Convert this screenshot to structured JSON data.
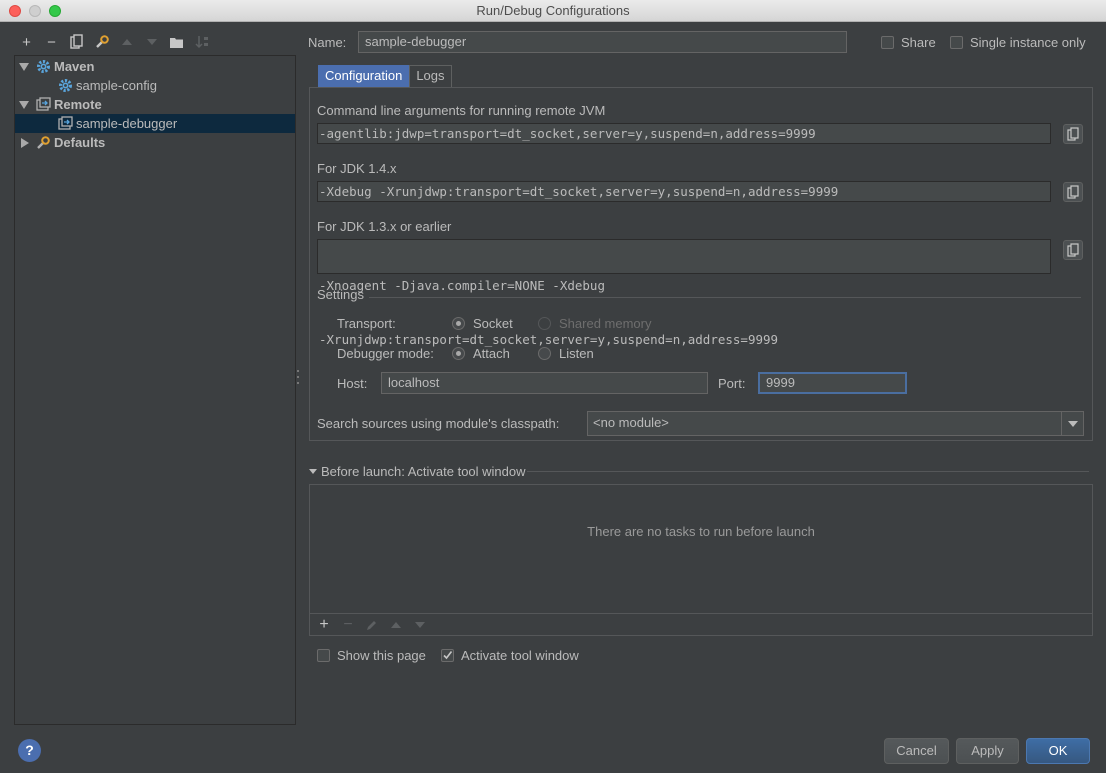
{
  "window": {
    "title": "Run/Debug Configurations"
  },
  "toolbar": {
    "add_label": "+",
    "remove_label": "−"
  },
  "tree": {
    "items": [
      {
        "label": "Maven"
      },
      {
        "label": "sample-config"
      },
      {
        "label": "Remote"
      },
      {
        "label": "sample-debugger"
      },
      {
        "label": "Defaults"
      }
    ]
  },
  "name": {
    "label": "Name:",
    "value": "sample-debugger"
  },
  "share": {
    "label": "Share"
  },
  "single_instance": {
    "label": "Single instance only"
  },
  "tabs": [
    {
      "label": "Configuration"
    },
    {
      "label": "Logs"
    }
  ],
  "config": {
    "cmdline_label": "Command line arguments for running remote JVM",
    "cmdline_value": "-agentlib:jdwp=transport=dt_socket,server=y,suspend=n,address=9999",
    "jdk14_label": "For JDK 1.4.x",
    "jdk14_value": "-Xdebug -Xrunjdwp:transport=dt_socket,server=y,suspend=n,address=9999",
    "jdk13_label": "For JDK 1.3.x or earlier",
    "jdk13_line1": "-Xnoagent -Djava.compiler=NONE -Xdebug",
    "jdk13_line2": "-Xrunjdwp:transport=dt_socket,server=y,suspend=n,address=9999",
    "settings_label": "Settings",
    "transport_label": "Transport:",
    "transport_options": [
      "Socket",
      "Shared memory"
    ],
    "debugger_mode_label": "Debugger mode:",
    "debugger_mode_options": [
      "Attach",
      "Listen"
    ],
    "host_label": "Host:",
    "host_value": "localhost",
    "port_label": "Port:",
    "port_value": "9999",
    "module_label": "Search sources using module's classpath:",
    "module_value": "<no module>"
  },
  "before_launch": {
    "title": "Before launch: Activate tool window",
    "empty_text": "There are no tasks to run before launch"
  },
  "show_page": {
    "label": "Show this page"
  },
  "activate_tool_window": {
    "label": "Activate tool window",
    "checked": true
  },
  "buttons": {
    "cancel": "Cancel",
    "apply": "Apply",
    "ok": "OK",
    "help": "?"
  },
  "colors": {
    "accent": "#4b6eaf",
    "selection": "#0d293e",
    "background": "#3c3f41"
  }
}
